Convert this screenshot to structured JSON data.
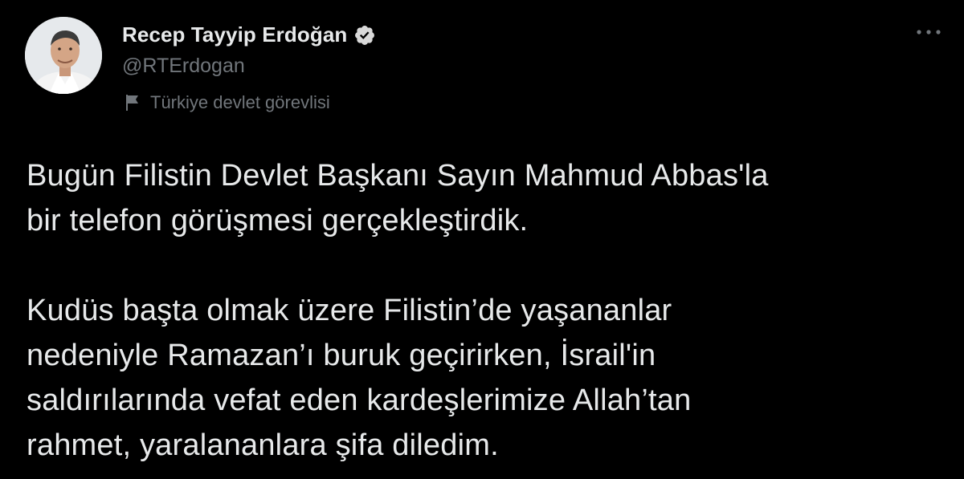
{
  "tweet": {
    "author": {
      "name": "Recep Tayyip Erdoğan",
      "handle": "@RTErdogan",
      "label": "Türkiye devlet görevlisi"
    },
    "body": {
      "paragraphs": [
        "Bugün Filistin Devlet Başkanı Sayın Mahmud Abbas'la\nbir telefon görüşmesi gerçekleştirdik.",
        "Kudüs başta olmak üzere Filistin’de yaşananlar\nnedeniyle Ramazan’ı buruk geçirirken, İsrail'in\nsaldırılarında vefat eden kardeşlerimize Allah’tan\nrahmet, yaralananlara şifa diledim."
      ]
    }
  },
  "colors": {
    "background": "#000000",
    "primary_text": "#e7e9ea",
    "secondary_text": "#71767b",
    "verified_fill": "#d9d9d9"
  },
  "icons": {
    "verified": "verified-badge-icon",
    "label": "flag-icon",
    "more": "more-options-icon"
  }
}
